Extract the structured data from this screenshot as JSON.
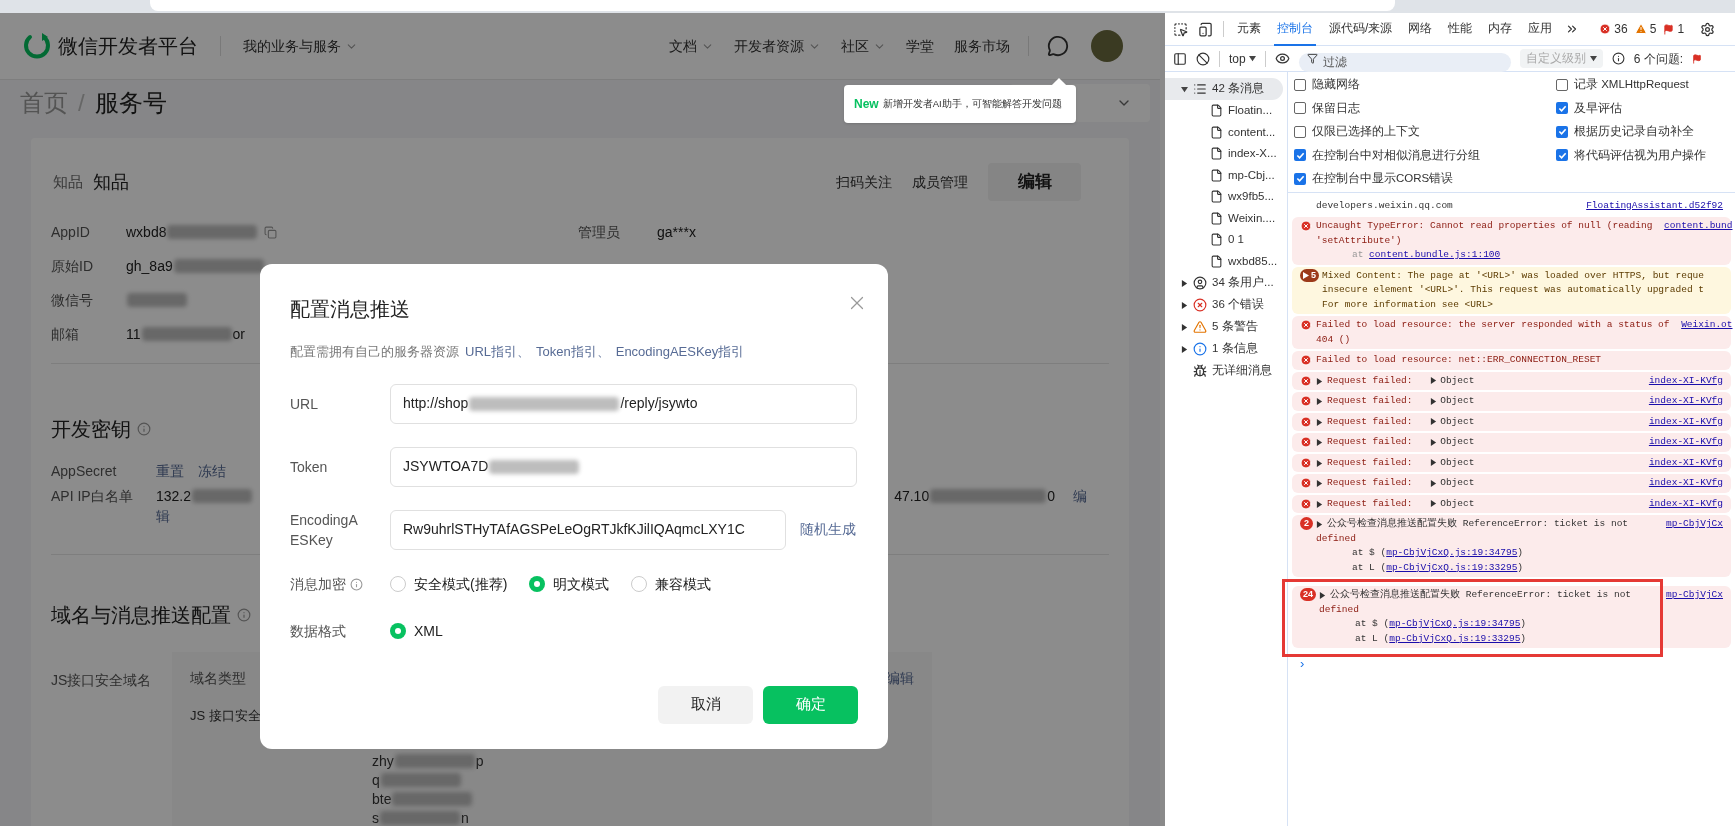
{
  "page": {
    "header": {
      "brand": "微信开发者平台",
      "business_menu": "我的业务与服务",
      "nav": [
        {
          "label": "文档",
          "dropdown": true
        },
        {
          "label": "开发者资源",
          "dropdown": true
        },
        {
          "label": "社区",
          "dropdown": true
        },
        {
          "label": "学堂",
          "dropdown": false
        },
        {
          "label": "服务市场",
          "dropdown": false
        }
      ]
    },
    "tooltip": {
      "badge": "New",
      "text": "新增开发者AI助手，可智能解答开发问题"
    },
    "breadcrumb": {
      "root": "首页",
      "separator": "/",
      "current": "服务号"
    },
    "account": {
      "logo_text": "知品",
      "name": "知品",
      "actions": [
        "扫码关注",
        "成员管理"
      ],
      "edit_button": "编辑",
      "fields": [
        {
          "label": "AppID",
          "prefix": "wxbd8",
          "copy_icon": true
        },
        {
          "label": "原始ID",
          "prefix": "gh_8a9",
          "copy_icon": false
        },
        {
          "label": "微信号",
          "copy_icon": false
        },
        {
          "label": "邮箱",
          "prefix": "11",
          "suffix": "or",
          "copy_icon": false
        }
      ],
      "admin": {
        "label": "管理员",
        "value": "ga***x"
      }
    },
    "dev_keys": {
      "title": "开发密钥",
      "secret_label": "AppSecret",
      "secret_links": [
        "重置",
        "冻结"
      ],
      "ip_label": "API IP白名单",
      "ip_prefix": "132.2",
      "ip_wrap": "辑",
      "ip2_prefix": "47.10",
      "ip2_suffix": "0",
      "ip2_link": "编"
    },
    "domain": {
      "title": "域名与消息推送配置",
      "js_label": "JS接口安全域名",
      "column": "域名类型",
      "edit": "编辑",
      "type_value": "JS 接口安全",
      "entries": [
        {
          "prefix": "zhy",
          "suffix": "p"
        },
        {
          "prefix": "q"
        },
        {
          "prefix": "bte"
        },
        {
          "prefix": "s",
          "suffix": "n"
        }
      ]
    }
  },
  "dialog": {
    "title": "配置消息推送",
    "description": "配置需拥有自己的服务器资源",
    "links": [
      "URL指引、",
      "Token指引、",
      "EncodingAESKey指引"
    ],
    "fields": [
      {
        "label": "URL",
        "prefix": "http://shop",
        "suffix": "/reply/jsywto",
        "blurred": true
      },
      {
        "label": "Token",
        "prefix": "JSYWTOA7D",
        "blurred": true
      },
      {
        "label": "EncodingAESKey",
        "prefix": "Rw9uhrlSTHyTAfAGSPeLeOgRTJkfKJilIQAqmcLXY1C",
        "blurred": false,
        "action": "随机生成"
      }
    ],
    "encryption": {
      "label": "消息加密",
      "options": [
        {
          "label": "安全模式(推荐)",
          "selected": false
        },
        {
          "label": "明文模式",
          "selected": true
        },
        {
          "label": "兼容模式",
          "selected": false
        }
      ]
    },
    "format": {
      "label": "数据格式",
      "options": [
        {
          "label": "XML",
          "selected": true
        }
      ]
    },
    "buttons": {
      "cancel": "取消",
      "confirm": "确定"
    }
  },
  "devtools": {
    "tabs": [
      {
        "label": "元素",
        "selected": false
      },
      {
        "label": "控制台",
        "selected": true
      },
      {
        "label": "源代码/来源",
        "selected": false
      },
      {
        "label": "网络",
        "selected": false
      },
      {
        "label": "性能",
        "selected": false
      },
      {
        "label": "内存",
        "selected": false
      },
      {
        "label": "应用",
        "selected": false
      }
    ],
    "counts": {
      "errors": "36",
      "warnings": "5",
      "issues": "1"
    },
    "context": "top",
    "filter_placeholder": "过滤",
    "level": "自定义级别",
    "issues_label": "6 个问题:",
    "sidebar": [
      {
        "label": "42 条消息",
        "kind": "all",
        "expandable": true,
        "expanded": true,
        "selected": true,
        "children": [
          {
            "label": "Floatin..."
          },
          {
            "label": "content..."
          },
          {
            "label": "index-X..."
          },
          {
            "label": "mp-Cbj..."
          },
          {
            "label": "wx9fb5..."
          },
          {
            "label": "Weixin...."
          },
          {
            "label": "0 1"
          },
          {
            "label": "wxbd85..."
          }
        ]
      },
      {
        "label": "34 条用户...",
        "kind": "user",
        "expandable": true,
        "expanded": false,
        "selected": false
      },
      {
        "label": "36 个错误",
        "kind": "error",
        "expandable": true,
        "expanded": false,
        "selected": false
      },
      {
        "label": "5 条警告",
        "kind": "warning",
        "expandable": true,
        "expanded": false,
        "selected": false
      },
      {
        "label": "1 条信息",
        "kind": "info",
        "expandable": true,
        "expanded": false,
        "selected": false
      },
      {
        "label": "无详细消息",
        "kind": "verbose",
        "expandable": false,
        "selected": false
      }
    ],
    "settings": [
      [
        {
          "label": "隐藏网络",
          "checked": false
        },
        {
          "label": "保留日志",
          "checked": false
        },
        {
          "label": "仅限已选择的上下文",
          "checked": false
        },
        {
          "label": "在控制台中对相似消息进行分组",
          "checked": true
        },
        {
          "label": "在控制台中显示CORS错误",
          "checked": true
        }
      ],
      [
        {
          "label": "记录 XMLHttpRequest",
          "checked": false
        },
        {
          "label": "及早评估",
          "checked": true
        },
        {
          "label": "根据历史记录自动补全",
          "checked": true
        },
        {
          "label": "将代码评估视为用户操作",
          "checked": true
        }
      ]
    ],
    "messages": [
      {
        "kind": "log",
        "text": "developers.weixin.qq.com",
        "source": "FloatingAssistant.d52f92"
      },
      {
        "kind": "error",
        "text": "Uncaught TypeError: Cannot read properties of null (reading ",
        "source": "content.bund",
        "lines": [
          "'setAttribute')"
        ],
        "stack": [
          {
            "prefix": "at ",
            "link": "content.bundle.js:1:100"
          }
        ]
      },
      {
        "kind": "warning",
        "count": "5",
        "text": "Mixed Content: The page at '<URL>' was loaded over HTTPS, but reque",
        "lines": [
          "insecure element '<URL>'. This request was automatically upgraded t",
          "For more information see <URL>"
        ]
      },
      {
        "kind": "error",
        "text": "Failed to load resource: the server responded with a status of ",
        "source": "Weixin.ot",
        "lines": [
          "404 ()"
        ]
      },
      {
        "kind": "error",
        "text": "Failed to load resource: net::ERR_CONNECTION_RESET"
      },
      {
        "kind": "error",
        "expandable": true,
        "text": "Request failed: ",
        "object": "Object",
        "source": "index-XI-KVfg"
      },
      {
        "kind": "error",
        "expandable": true,
        "text": "Request failed: ",
        "object": "Object",
        "source": "index-XI-KVfg"
      },
      {
        "kind": "error",
        "expandable": true,
        "text": "Request failed: ",
        "object": "Object",
        "source": "index-XI-KVfg"
      },
      {
        "kind": "error",
        "expandable": true,
        "text": "Request failed: ",
        "object": "Object",
        "source": "index-XI-KVfg"
      },
      {
        "kind": "error",
        "expandable": true,
        "text": "Request failed: ",
        "object": "Object",
        "source": "index-XI-KVfg"
      },
      {
        "kind": "error",
        "expandable": true,
        "text": "Request failed: ",
        "object": "Object",
        "source": "index-XI-KVfg"
      },
      {
        "kind": "error",
        "expandable": true,
        "text": "Request failed: ",
        "object": "Object",
        "source": "index-XI-KVfg"
      },
      {
        "kind": "error",
        "count": "2",
        "expandable": true,
        "text": "公众号检查消息推送配置失败 ReferenceError: ticket is not",
        "source": "mp-CbjVjCx",
        "lines": [
          "defined"
        ],
        "stack": [
          {
            "prefix": "at $ (",
            "link": "mp-CbjVjCxQ.js:19:34795",
            "suffix": ")"
          },
          {
            "prefix": "at L (",
            "link": "mp-CbjVjCxQ.js:19:33295",
            "suffix": ")"
          }
        ]
      },
      {
        "kind": "error",
        "count": "24",
        "expandable": true,
        "text": "公众号检查消息推送配置失败 ReferenceError: ticket is not",
        "source": "mp-CbjVjCx",
        "lines": [
          "defined"
        ],
        "stack": [
          {
            "prefix": "at $ (",
            "link": "mp-CbjVjCxQ.js:19:34795",
            "suffix": ")"
          },
          {
            "prefix": "at L (",
            "link": "mp-CbjVjCxQ.js:19:33295",
            "suffix": ")"
          }
        ],
        "highlighted": true
      }
    ],
    "prompt": "›"
  }
}
